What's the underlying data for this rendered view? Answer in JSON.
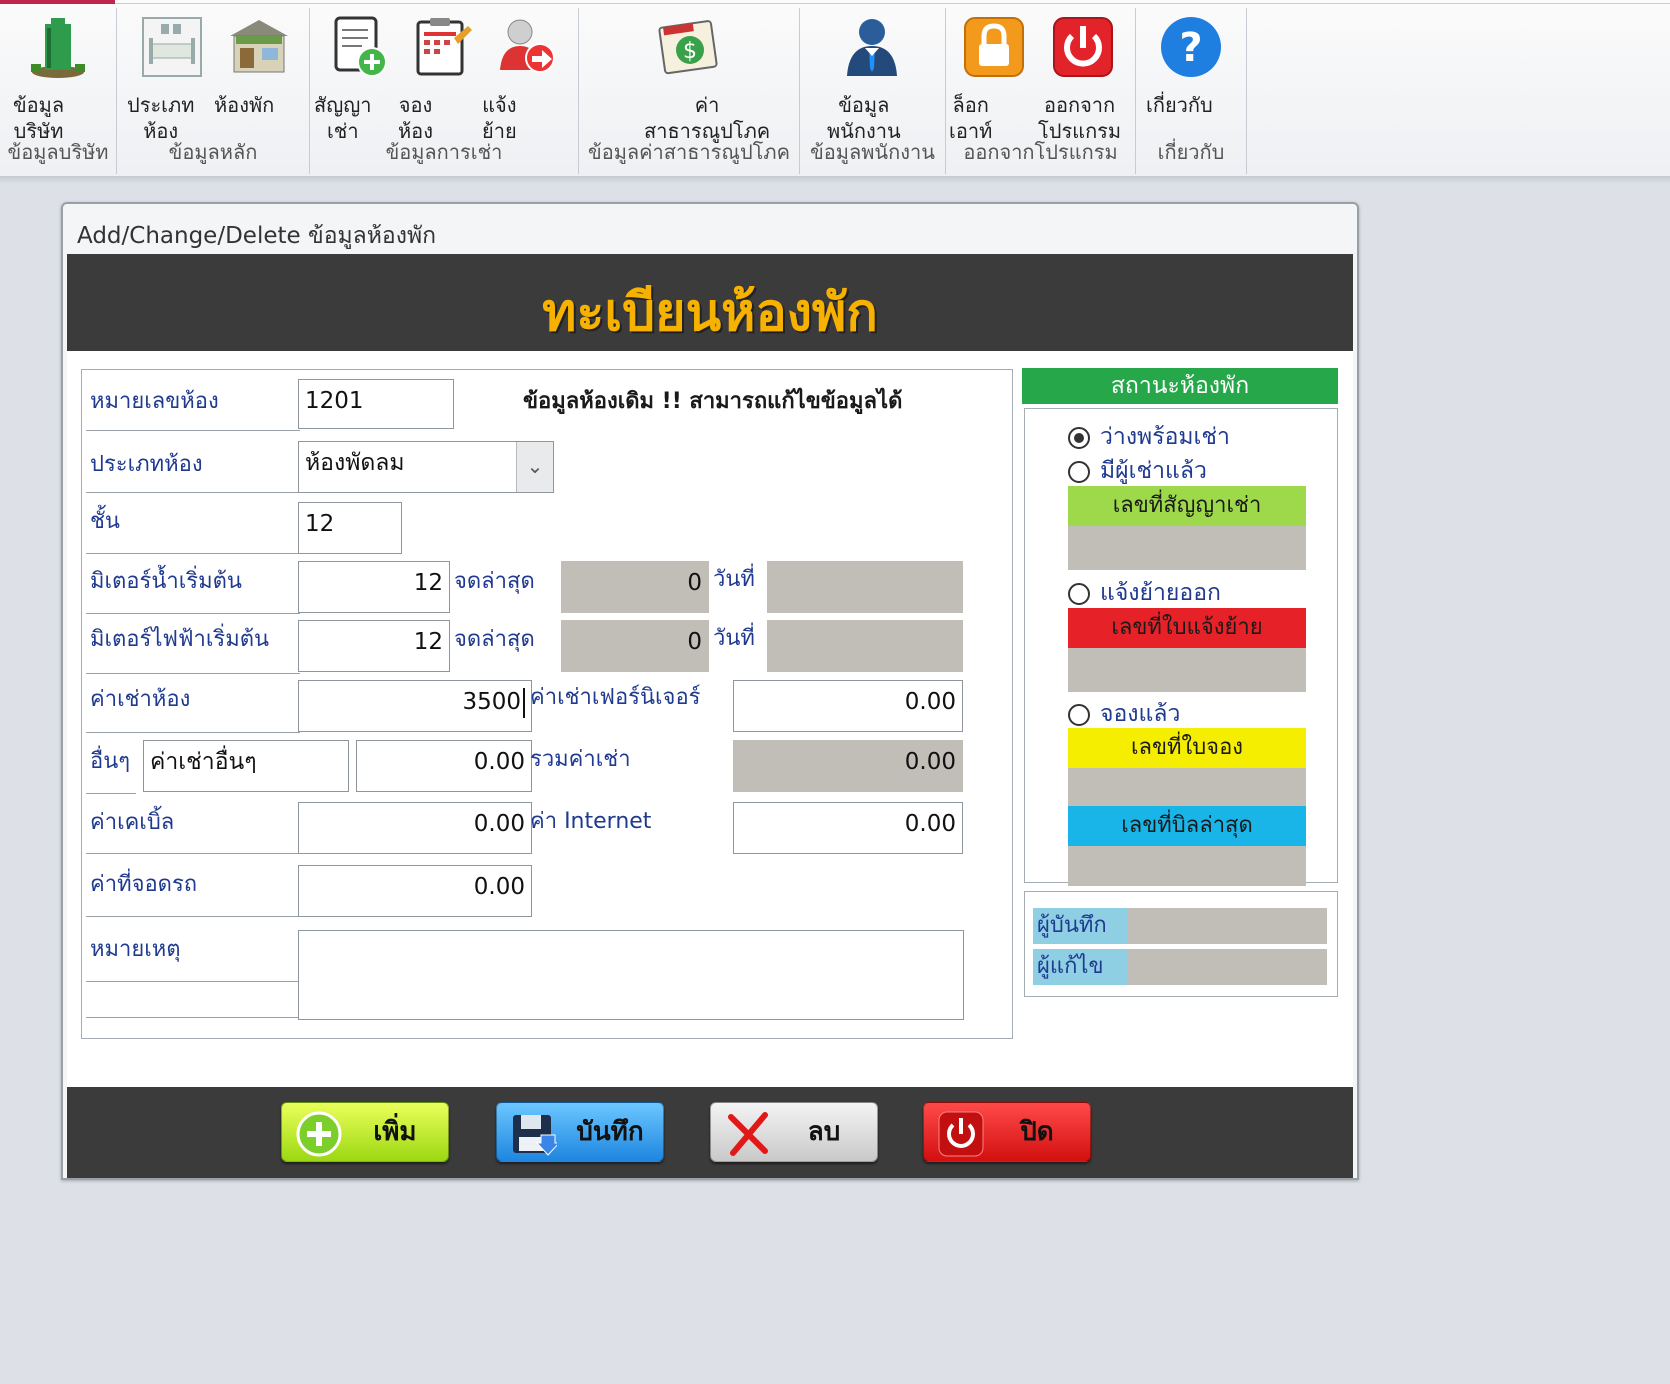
{
  "ribbon": {
    "groups": [
      {
        "label": "ข้อมูลบริษัท",
        "buttons": [
          {
            "label": "ข้อมูล\nบริษัท",
            "icon": "building-icon"
          }
        ]
      },
      {
        "label": "ข้อมูลหลัก",
        "buttons": [
          {
            "label": "ประเภท\nห้อง",
            "icon": "room-type-icon"
          },
          {
            "label": "ห้องพัก",
            "icon": "room-icon"
          }
        ]
      },
      {
        "label": "ข้อมูลการเช่า",
        "buttons": [
          {
            "label": "สัญญา\nเช่า",
            "icon": "contract-icon"
          },
          {
            "label": "จอง\nห้อง",
            "icon": "booking-icon"
          },
          {
            "label": "แจ้ง\nย้าย",
            "icon": "move-out-icon"
          }
        ]
      },
      {
        "label": "ข้อมูลค่าสาธารณูปโภค",
        "buttons": [
          {
            "label": "ค่า\nสาธารณูปโภค",
            "icon": "bill-icon"
          }
        ]
      },
      {
        "label": "ข้อมูลพนักงาน",
        "buttons": [
          {
            "label": "ข้อมูล\nพนักงาน",
            "icon": "employee-icon"
          }
        ]
      },
      {
        "label": "ออกจากโปรแกรม",
        "buttons": [
          {
            "label": "ล็อก\nเอาท์",
            "icon": "lock-icon"
          },
          {
            "label": "ออกจาก\nโปรแกรม",
            "icon": "power-icon"
          }
        ]
      },
      {
        "label": "เกี่ยวกับ",
        "buttons": [
          {
            "label": "เกี่ยวกับ",
            "icon": "help-icon"
          }
        ]
      }
    ]
  },
  "form": {
    "caption": "Add/Change/Delete ข้อมูลห้องพัก",
    "title": "ทะเบียนห้องพัก",
    "notice": "ข้อมูลห้องเดิม !!  สามารถแก้ไขข้อมูลได้",
    "fields": {
      "room_no": {
        "label": "หมายเลขห้อง",
        "value": "1201"
      },
      "room_type": {
        "label": "ประเภทห้อง",
        "value": "ห้องพัดลม"
      },
      "floor": {
        "label": "ชั้น",
        "value": "12"
      },
      "water_meter": {
        "label": "มิเตอร์น้ำเริ่มต้น",
        "value": "12",
        "latest_label": "จดล่าสุด",
        "latest_value": "0",
        "date_label": "วันที่",
        "date_value": ""
      },
      "elec_meter": {
        "label": "มิเตอร์ไฟฟ้าเริ่มต้น",
        "value": "12",
        "latest_label": "จดล่าสุด",
        "latest_value": "0",
        "date_label": "วันที่",
        "date_value": ""
      },
      "rent": {
        "label": "ค่าเช่าห้อง",
        "value": "3500"
      },
      "furniture": {
        "label": "ค่าเช่าเฟอร์นิเจอร์",
        "value": "0.00"
      },
      "other": {
        "label": "อื่นๆ",
        "name_value": "ค่าเช่าอื่นๆ",
        "value": "0.00"
      },
      "total": {
        "label": "รวมค่าเช่า",
        "value": "0.00"
      },
      "cable": {
        "label": "ค่าเคเบิ้ล",
        "value": "0.00"
      },
      "internet": {
        "label": "ค่า Internet",
        "value": "0.00"
      },
      "parking": {
        "label": "ค่าที่จอดรถ",
        "value": "0.00"
      },
      "note": {
        "label": "หมายเหตุ",
        "value": ""
      }
    },
    "status": {
      "header": "สถานะห้องพัก",
      "options": [
        {
          "label": "ว่างพร้อมเช่า",
          "checked": true
        },
        {
          "label": "มีผู้เช่าแล้ว",
          "checked": false
        },
        {
          "label": "แจ้งย้ายออก",
          "checked": false
        },
        {
          "label": "จองแล้ว",
          "checked": false
        }
      ],
      "contract_no_label": "เลขที่สัญญาเช่า",
      "moveout_no_label": "เลขที่ใบแจ้งย้าย",
      "booking_no_label": "เลขที่ใบจอง",
      "last_bill_label": "เลขที่บิลล่าสุด",
      "colors": {
        "header": "#26a84a",
        "contract": "#9dd94a",
        "moveout": "#e62228",
        "booking": "#f5ee00",
        "bill": "#19b5e8"
      }
    },
    "record": {
      "created_by_label": "ผู้บันทึก",
      "created_by": "",
      "edited_by_label": "ผู้แก้ไข",
      "edited_by": ""
    },
    "buttons": {
      "add": "เพิ่ม",
      "save": "บันทึก",
      "delete": "ลบ",
      "close": "ปิด"
    }
  }
}
